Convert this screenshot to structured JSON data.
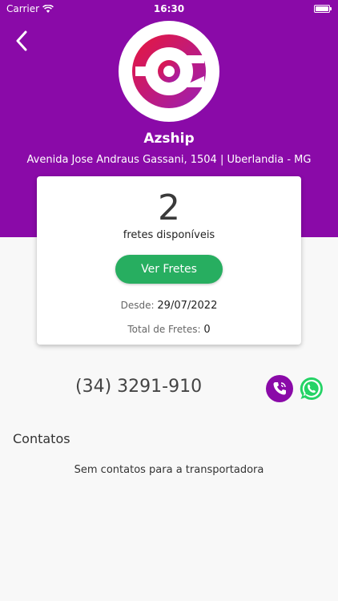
{
  "status_bar": {
    "carrier": "Carrier",
    "time": "16:30"
  },
  "company": {
    "name": "Azship",
    "address": "Avenida Jose Andraus Gassani, 1504 | Uberlandia - MG"
  },
  "card": {
    "freight_count": "2",
    "freight_label": "fretes disponíveis",
    "view_button": "Ver Fretes",
    "since_label": "Desde:",
    "since_value": "29/07/2022",
    "total_label": "Total de Fretes:",
    "total_value": "0"
  },
  "contact": {
    "phone": "(34) 3291-910"
  },
  "contacts_section": {
    "title": "Contatos",
    "empty_message": "Sem contatos para a transportadora"
  },
  "colors": {
    "header": "#8a0aa8",
    "button_green": "#27ae60",
    "whatsapp": "#25d366"
  },
  "icons": [
    "wifi-icon",
    "battery-icon",
    "back-arrow-icon",
    "company-logo",
    "phone-icon",
    "whatsapp-icon"
  ]
}
